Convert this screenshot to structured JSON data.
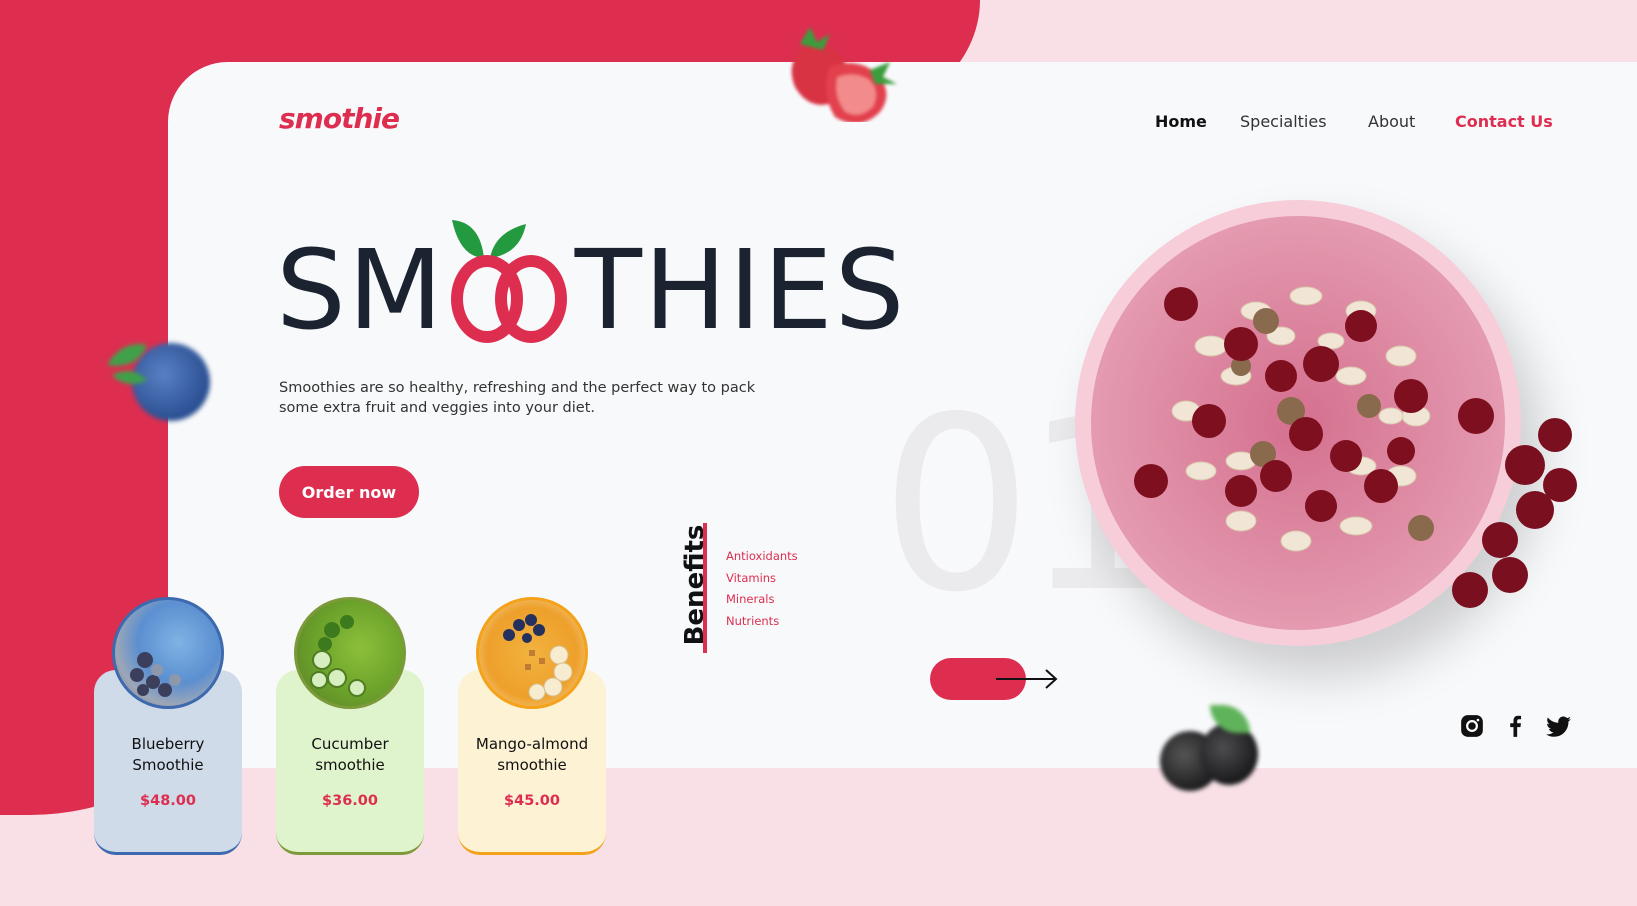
{
  "brand": {
    "logo": "smothie"
  },
  "nav": {
    "home": "Home",
    "specialties": "Specialties",
    "about": "About",
    "contact": "Contact Us"
  },
  "hero": {
    "title_left": "SM",
    "title_right": "THIES",
    "description": "Smoothies are so healthy, refreshing and the perfect way to pack some extra fruit and veggies into your diet.",
    "cta": "Order now"
  },
  "benefits": {
    "title": "Benefits",
    "items": [
      "Antioxidants",
      "Vitamins",
      "Minerals",
      "Nutrients"
    ]
  },
  "slide": {
    "number": "01"
  },
  "cards": [
    {
      "name_line1": "Blueberry",
      "name_line2": "Smoothie",
      "price": "$48.00",
      "bg": "#cfdbe9",
      "accent": "#3d6aae"
    },
    {
      "name_line1": "Cucumber",
      "name_line2": "smoothie",
      "price": "$36.00",
      "bg": "#dff4cd",
      "accent": "#7c9a3a"
    },
    {
      "name_line1": "Mango-almond",
      "name_line2": "smoothie",
      "price": "$45.00",
      "bg": "#fdf2d3",
      "accent": "#f4a21a"
    }
  ],
  "social": [
    "instagram-icon",
    "facebook-icon",
    "twitter-icon"
  ],
  "colors": {
    "brand_red": "#dd2e50",
    "dark_text": "#1b2331",
    "pink_bg": "#f8e0e6",
    "panel_bg": "#f8f9fb"
  }
}
